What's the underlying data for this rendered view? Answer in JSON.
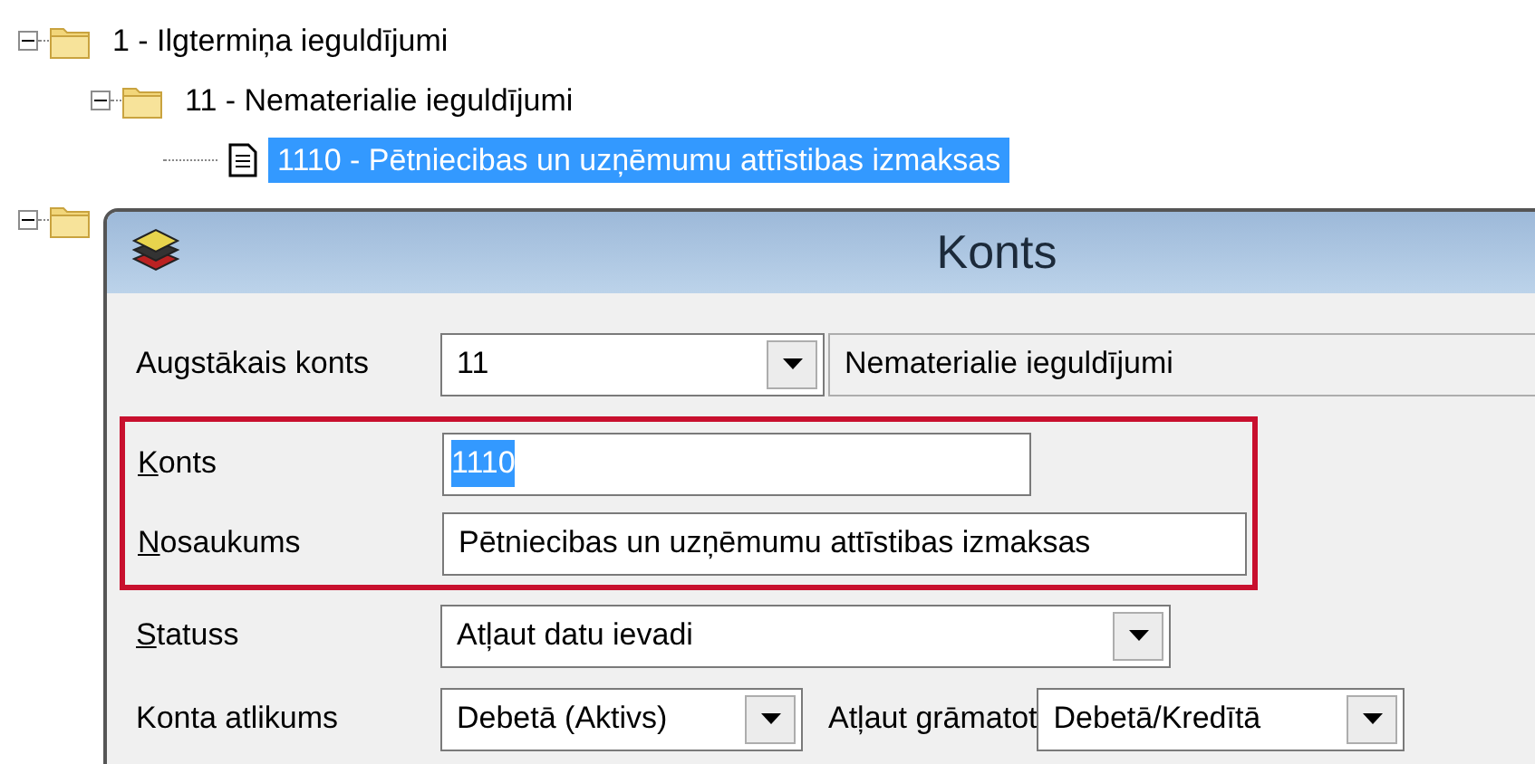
{
  "tree": [
    {
      "label": "1 - Ilgtermiņa ieguldījumi",
      "expanded": true,
      "children": [
        {
          "label": "11 - Nematerialie ieguldījumi",
          "expanded": true,
          "children": [
            {
              "label": "1110 - Pētniecibas un uzņēmumu attīstibas izmaksas",
              "selected": true
            }
          ]
        }
      ]
    },
    {
      "expanded": true
    }
  ],
  "dialog": {
    "title": "Konts",
    "parent_account": {
      "label": "Augstākais konts",
      "value": "11",
      "name": "Nematerialie ieguldījumi"
    },
    "account": {
      "label": "Konts",
      "mnemonic": true,
      "value": "1110",
      "value_selected": true
    },
    "account_name": {
      "label": "Nosaukums",
      "mnemonic": true,
      "value": "Pētniecibas un uzņēmumu attīstibas izmaksas"
    },
    "highlighted": true,
    "status": {
      "label": "Statuss",
      "mnemonic": true,
      "value": "Atļaut datu ievadi"
    },
    "balance": {
      "label": "Konta atlikums",
      "value": "Debetā (Aktivs)"
    },
    "posting": {
      "label": "Atļaut grāmatot",
      "value": "Debetā/Kredītā"
    }
  }
}
